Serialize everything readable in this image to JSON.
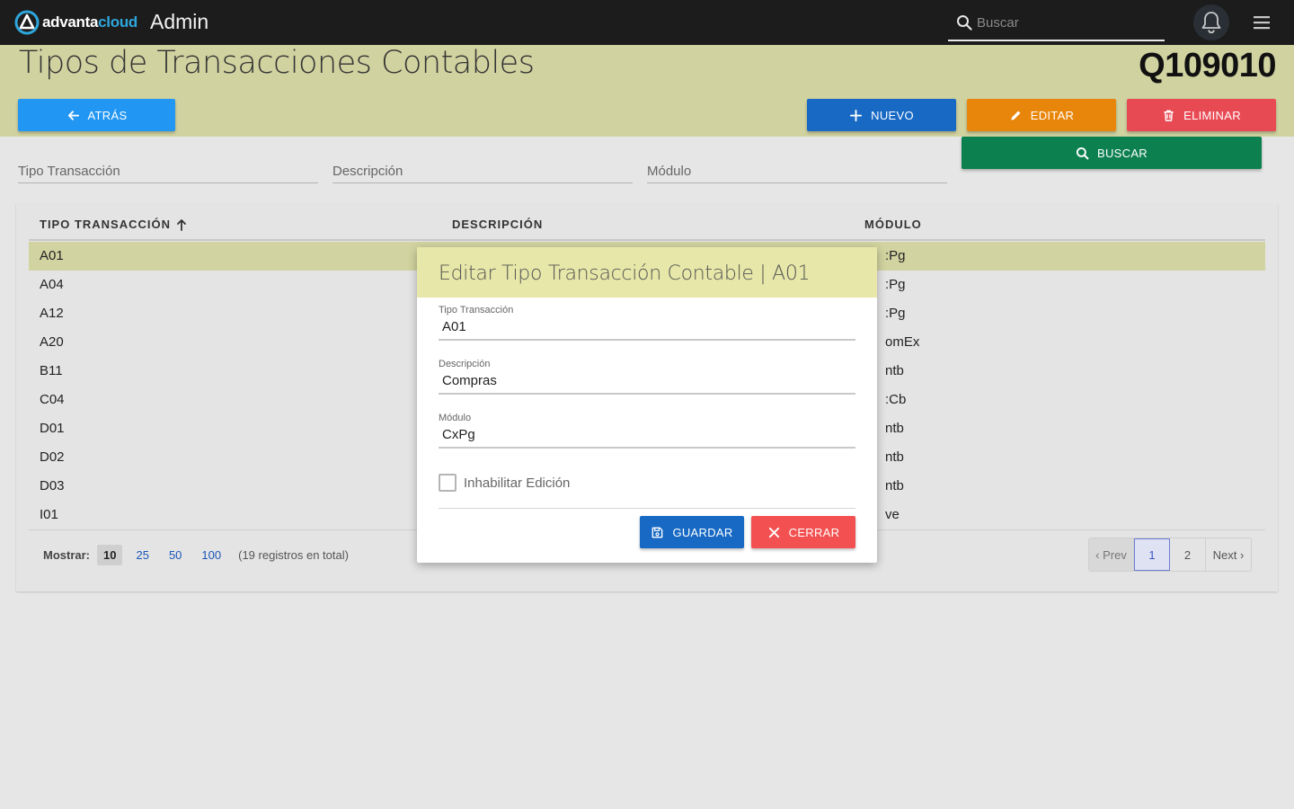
{
  "navbar": {
    "logo": {
      "brand_part1": "advanta",
      "brand_part2": "cloud"
    },
    "app_name": "Admin",
    "search_placeholder": "Buscar",
    "icons": {
      "search": "search-icon",
      "bell": "bell-icon",
      "menu": "hamburger-menu-icon"
    }
  },
  "header": {
    "title": "Tipos de Transacciones Contables",
    "code": "Q109010",
    "buttons": {
      "back": "ATRÁS",
      "new": "NUEVO",
      "edit": "EDITAR",
      "delete": "ELIMINAR",
      "search": "BUSCAR"
    },
    "colors": {
      "band": "#d0d2a0",
      "back": "#2196f3",
      "new": "#1769c4",
      "edit": "#e8860c",
      "delete": "#e84a54",
      "search": "#0d8050"
    }
  },
  "filters": {
    "tipo_placeholder": "Tipo Transacción",
    "descripcion_placeholder": "Descripción",
    "modulo_placeholder": "Módulo"
  },
  "table": {
    "columns": [
      "TIPO TRANSACCIÓN",
      "DESCRIPCIÓN",
      "MÓDULO"
    ],
    "sort_indicator": "arrow-up-icon",
    "selected_row": 0,
    "rows": [
      {
        "tipo": "A01",
        "modulo": ":Pg"
      },
      {
        "tipo": "A04",
        "modulo": ":Pg"
      },
      {
        "tipo": "A12",
        "modulo": ":Pg"
      },
      {
        "tipo": "A20",
        "modulo": "omEx"
      },
      {
        "tipo": "B11",
        "modulo": "ntb"
      },
      {
        "tipo": "C04",
        "modulo": ":Cb"
      },
      {
        "tipo": "D01",
        "modulo": "ntb"
      },
      {
        "tipo": "D02",
        "modulo": "ntb"
      },
      {
        "tipo": "D03",
        "modulo": "ntb"
      },
      {
        "tipo": "I01",
        "modulo": "ve"
      }
    ]
  },
  "pagination": {
    "show_label": "Mostrar:",
    "page_sizes": [
      "10",
      "25",
      "50",
      "100"
    ],
    "active_size": "10",
    "total_text": "(19 registros en total)",
    "prev": "‹ Prev",
    "pages": [
      "1",
      "2"
    ],
    "active_page": "1",
    "next": "Next ›"
  },
  "modal": {
    "title": "Editar Tipo Transacción Contable | A01",
    "fields": {
      "tipo": {
        "label": "Tipo Transacción",
        "value": "A01"
      },
      "descripcion": {
        "label": "Descripción",
        "value": "Compras"
      },
      "modulo": {
        "label": "Módulo",
        "value": "CxPg"
      }
    },
    "checkbox_label": "Inhabilitar Edición",
    "checkbox_checked": false,
    "save_label": "GUARDAR",
    "close_label": "CERRAR"
  }
}
